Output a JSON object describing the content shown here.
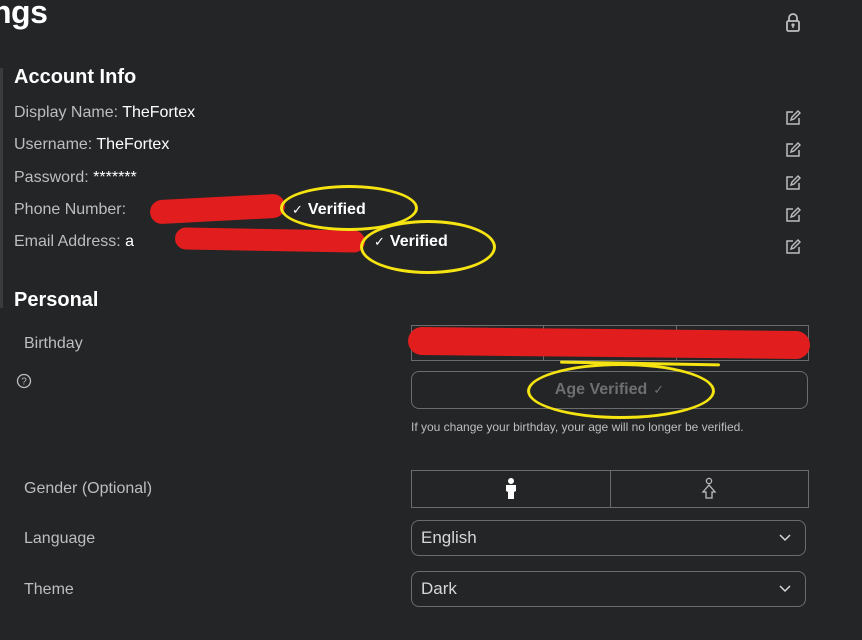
{
  "header": {
    "title": "ngs",
    "lock_icon": "lock-icon"
  },
  "account_info": {
    "title": "Account Info",
    "rows": [
      {
        "label": "Display Name:",
        "value": "TheFortex"
      },
      {
        "label": "Username:",
        "value": "TheFortex"
      },
      {
        "label": "Password:",
        "value": "*******"
      },
      {
        "label": "Phone Number:",
        "value": "",
        "status": "Verified",
        "redacted": true
      },
      {
        "label": "Email Address:",
        "value": "a",
        "status": "Verified",
        "redacted": true
      }
    ],
    "edit_icon": "edit-icon"
  },
  "personal": {
    "title": "Personal",
    "birthday": {
      "label": "Birthday",
      "help_icon": "question-circle-icon",
      "age_verified_label": "Age Verified",
      "hint": "If you change your birthday, your age will no longer be verified."
    },
    "gender": {
      "label": "Gender (Optional)",
      "options": [
        "male",
        "female"
      ],
      "selected": "male"
    },
    "language": {
      "label": "Language",
      "value": "English"
    },
    "theme": {
      "label": "Theme",
      "value": "Dark"
    }
  },
  "colors": {
    "background": "#232527",
    "text": "#bdbebe",
    "annotation_red": "#e11d1d",
    "annotation_yellow": "#f5e312"
  }
}
